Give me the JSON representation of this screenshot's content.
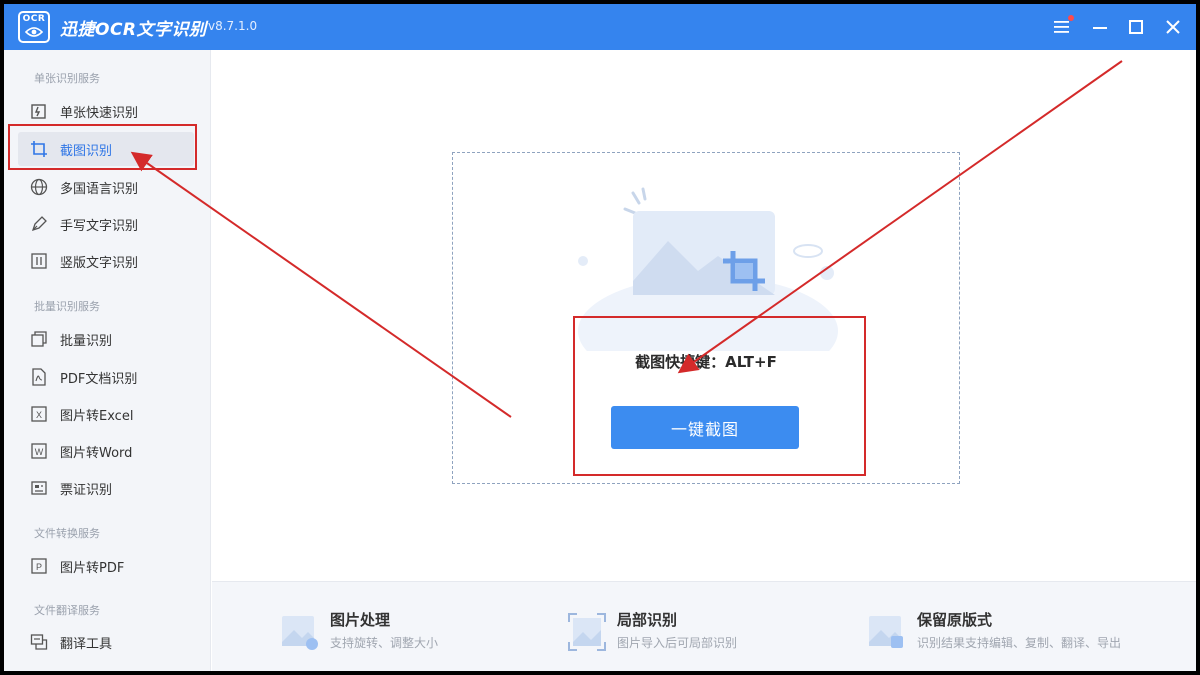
{
  "app": {
    "logo_text": "OCR",
    "title": "迅捷OCR文字识别",
    "version": "v8.7.1.0"
  },
  "sidebar": {
    "sections": [
      {
        "title": "单张识别服务",
        "items": [
          {
            "label": "单张快速识别",
            "icon": "quick-scan-icon"
          },
          {
            "label": "截图识别",
            "icon": "crop-icon",
            "active": true
          },
          {
            "label": "多国语言识别",
            "icon": "globe-icon"
          },
          {
            "label": "手写文字识别",
            "icon": "pen-icon"
          },
          {
            "label": "竖版文字识别",
            "icon": "vertical-text-icon"
          }
        ]
      },
      {
        "title": "批量识别服务",
        "items": [
          {
            "label": "批量识别",
            "icon": "batch-icon"
          },
          {
            "label": "PDF文档识别",
            "icon": "pdf-icon"
          },
          {
            "label": "图片转Excel",
            "icon": "excel-icon"
          },
          {
            "label": "图片转Word",
            "icon": "word-icon"
          },
          {
            "label": "票证识别",
            "icon": "ticket-icon"
          }
        ]
      },
      {
        "title": "文件转换服务",
        "items": [
          {
            "label": "图片转PDF",
            "icon": "image-to-pdf-icon"
          }
        ]
      },
      {
        "title": "文件翻译服务",
        "items": [
          {
            "label": "翻译工具",
            "icon": "translate-icon"
          }
        ]
      }
    ]
  },
  "main": {
    "shortcut_text": "截图快捷键：ALT+F",
    "capture_button": "一键截图"
  },
  "features": [
    {
      "title": "图片处理",
      "desc": "支持旋转、调整大小",
      "icon": "image-edit-icon"
    },
    {
      "title": "局部识别",
      "desc": "图片导入后可局部识别",
      "icon": "partial-scan-icon"
    },
    {
      "title": "保留原版式",
      "desc": "识别结果支持编辑、复制、翻译、导出",
      "icon": "layout-icon"
    }
  ],
  "colors": {
    "brand": "#3584ee",
    "button": "#3c8cf0",
    "annotation": "#d42a2a",
    "active_text": "#2f76e6"
  }
}
